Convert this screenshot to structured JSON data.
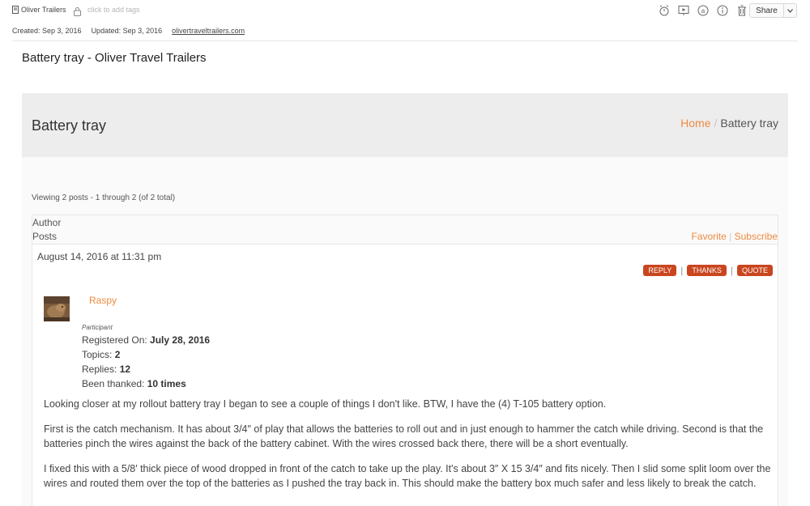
{
  "note": {
    "notebook": "Oliver Trailers",
    "tags_placeholder": "click to add tags",
    "share_label": "Share",
    "created": "Created: Sep 3, 2016",
    "updated": "Updated: Sep 3, 2016",
    "url": "olivertraveltrailers.com",
    "title": "Battery tray - Oliver Travel Trailers"
  },
  "page": {
    "title": "Battery tray",
    "breadcrumb": {
      "home": "Home",
      "separator": "/",
      "current": "Battery tray"
    },
    "viewing": "Viewing 2 posts - 1 through 2 (of 2 total)",
    "header": {
      "author": "Author",
      "posts": "Posts",
      "favorite": "Favorite",
      "separator": "|",
      "subscribe": "Subscribe"
    }
  },
  "post": {
    "date": "August 14, 2016 at 11:31 pm",
    "actions": {
      "reply": "REPLY",
      "thanks": "THANKS",
      "quote": "QUOTE",
      "separator": "|"
    },
    "author": {
      "name": "Raspy",
      "role": "Participant",
      "registered_label": "Registered On: ",
      "registered_value": "July 28, 2016",
      "topics_label": "Topics: ",
      "topics_value": "2",
      "replies_label": "Replies: ",
      "replies_value": "12",
      "thanked_label": "Been thanked: ",
      "thanked_value": "10 times"
    },
    "paragraphs": [
      "Looking closer at my rollout battery tray I began to see a couple of things I don't like.  BTW, I have the (4) T-105 battery option.",
      "First is the catch mechanism.  It has about 3/4″ of play that allows the batteries to roll out and in just enough to hammer the catch while driving.  Second is that the batteries pinch the wires against the back of the battery cabinet.  With the wires crossed back there, there will be a short eventually.",
      "I fixed this with a 5/8′ thick piece of wood dropped in front of the catch to take up the play.  It's about 3″ X 15 3/4″ and fits nicely.  Then I slid some split loom over the wires and routed them over the top of the batteries as I pushed the tray back in.    This should make the battery box much safer and less likely to break the catch."
    ]
  },
  "colors": {
    "accent": "#ee8a3f",
    "button": "#c9461f",
    "titlebar": "#ededed"
  }
}
